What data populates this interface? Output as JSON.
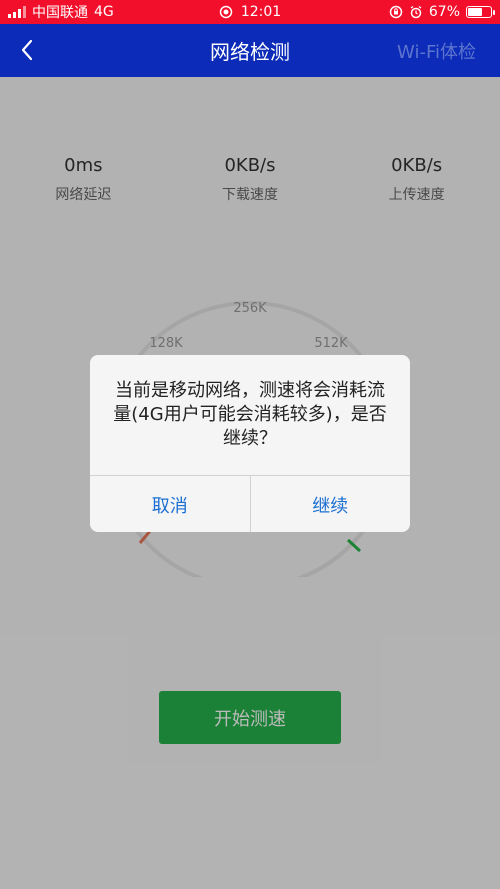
{
  "status_bar": {
    "carrier": "中国联通",
    "network": "4G",
    "time": "12:01",
    "battery_percent": "67%",
    "battery_level": 0.67
  },
  "nav": {
    "title": "网络检测",
    "right_action": "Wi-Fi体检"
  },
  "metrics": [
    {
      "value": "0ms",
      "label": "网络延迟"
    },
    {
      "value": "0KB/s",
      "label": "下载速度"
    },
    {
      "value": "0KB/s",
      "label": "上传速度"
    }
  ],
  "gauge": {
    "tick_labels": [
      "128K",
      "256K",
      "512K"
    ]
  },
  "start_button": "开始测速",
  "dialog": {
    "message": "当前是移动网络，测速将会消耗流量(4G用户可能会消耗较多)，是否继续？",
    "cancel": "取消",
    "confirm": "继续"
  },
  "colors": {
    "status_bar": "#f20f2c",
    "nav_bar": "#0b2bb8",
    "start_button": "#24b14a",
    "dialog_button_text": "#1a6fd1"
  }
}
